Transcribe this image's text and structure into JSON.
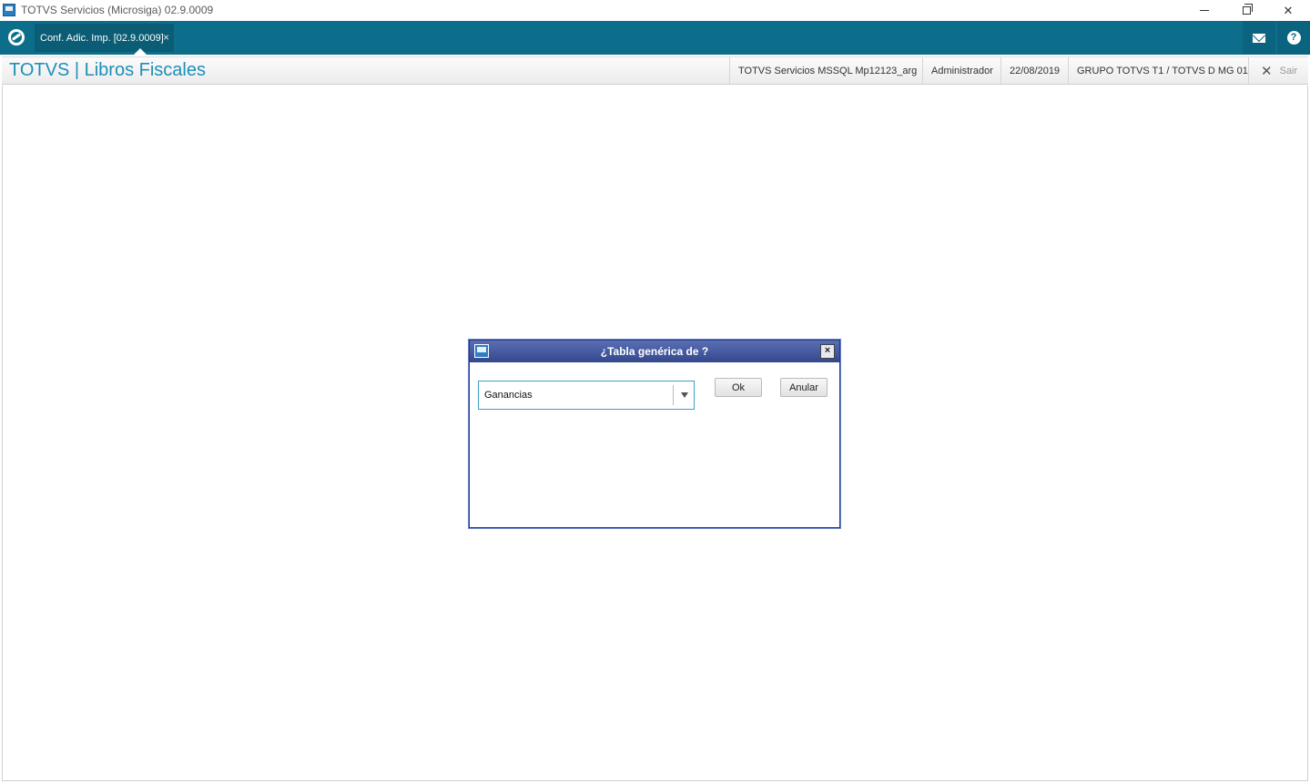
{
  "window": {
    "title": "TOTVS Servicios (Microsiga) 02.9.0009"
  },
  "tabbar": {
    "active_tab": "Conf. Adic. Imp. [02.9.0009]",
    "tab_close": "×",
    "help_glyph": "?"
  },
  "header": {
    "app_title": "TOTVS | Libros Fiscales",
    "environment": "TOTVS Servicios MSSQL Mp12123_arg",
    "user": "Administrador",
    "date": "22/08/2019",
    "group": "GRUPO TOTVS T1 / TOTVS D MG 01",
    "exit_glyph": "✕",
    "exit_label": "Sair"
  },
  "dialog": {
    "title": "¿Tabla genérica de ?",
    "close_glyph": "×",
    "select_value": "Ganancias",
    "ok_label": "Ok",
    "cancel_label": "Anular"
  },
  "colors": {
    "tabbar": "#0c6e8a",
    "accent_title": "#1d8fb8",
    "dialog_titlebar": "#3f52a0"
  }
}
